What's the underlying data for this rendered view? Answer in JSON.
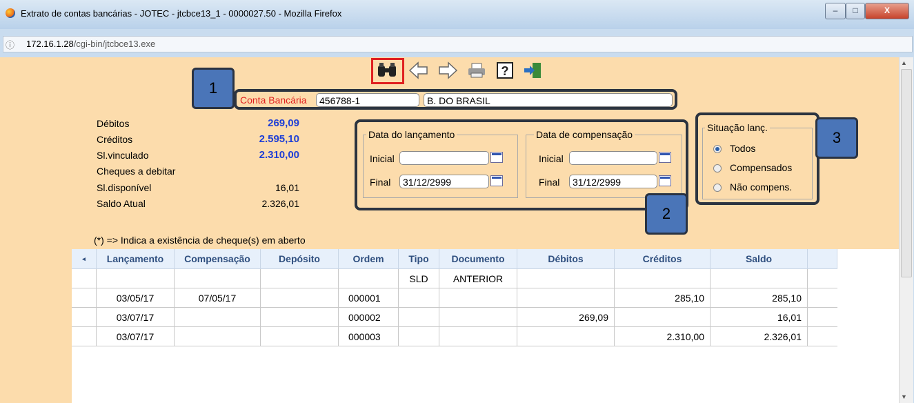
{
  "window": {
    "title": "Extrato de contas bancárias - JOTEC - jtcbce13_1 - 0000027.50 - Mozilla Firefox",
    "min": "–",
    "max": "□",
    "close": "X"
  },
  "urlbar": {
    "host": "172.16.1.28",
    "path": "/cgi-bin/jtcbce13.exe"
  },
  "toolbar": {
    "icons": [
      "binoculars-icon",
      "arrow-left-icon",
      "arrow-right-icon",
      "printer-icon",
      "help-icon",
      "exit-icon"
    ]
  },
  "callouts": [
    "1",
    "2",
    "3"
  ],
  "account": {
    "label": "Conta Bancária",
    "number": "456788-1",
    "bank": "B. DO BRASIL"
  },
  "summary": [
    {
      "label": "Débitos",
      "value": "269,09",
      "highlight": true
    },
    {
      "label": "Créditos",
      "value": "2.595,10",
      "highlight": true
    },
    {
      "label": "Sl.vinculado",
      "value": "2.310,00",
      "highlight": true
    },
    {
      "label": "Cheques a debitar",
      "value": "",
      "highlight": false
    },
    {
      "label": "Sl.disponível",
      "value": "16,01",
      "highlight": false
    },
    {
      "label": "Saldo Atual",
      "value": "2.326,01",
      "highlight": false
    }
  ],
  "dates": {
    "lancamento": {
      "legend": "Data do lançamento",
      "inicial_label": "Inicial",
      "inicial": "",
      "final_label": "Final",
      "final": "31/12/2999"
    },
    "compensacao": {
      "legend": "Data de compensação",
      "inicial_label": "Inicial",
      "inicial": "",
      "final_label": "Final",
      "final": "31/12/2999"
    }
  },
  "situacao": {
    "legend": "Situação lanç.",
    "options": [
      "Todos",
      "Compensados",
      "Não compens."
    ],
    "selected": "Todos"
  },
  "note": "(*) => Indica a existência de cheque(s) em aberto",
  "table": {
    "columns": [
      "Lançamento",
      "Compensação",
      "Depósito",
      "Ordem",
      "Tipo",
      "Documento",
      "Débitos",
      "Créditos",
      "Saldo"
    ],
    "rows": [
      [
        "",
        "",
        "",
        "",
        "SLD",
        "ANTERIOR",
        "",
        "",
        ""
      ],
      [
        "03/05/17",
        "07/05/17",
        "",
        "000001",
        "",
        "",
        "",
        "285,10",
        "285,10"
      ],
      [
        "03/07/17",
        "",
        "",
        "000002",
        "",
        "",
        "269,09",
        "",
        "16,01"
      ],
      [
        "03/07/17",
        "",
        "",
        "000003",
        "",
        "",
        "",
        "2.310,00",
        "2.326,01"
      ]
    ]
  },
  "colors": {
    "content_bg": "#fcdcac",
    "accent_blue": "#1f3fd6",
    "label_red": "#e02020",
    "callout": "#4a75b8"
  }
}
